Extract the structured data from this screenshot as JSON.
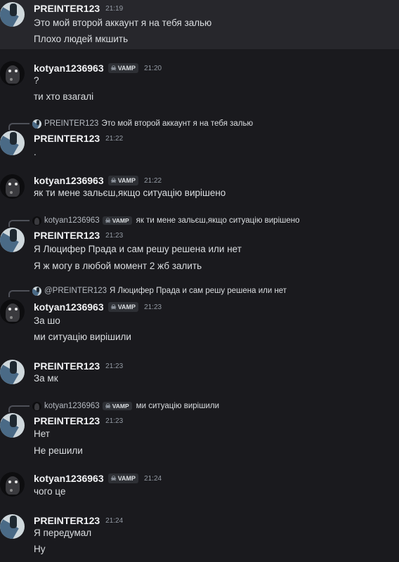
{
  "messages": [
    {
      "user": "PREINTER123",
      "time": "21:19",
      "lines": [
        "Это мой второй аккаунт я на тебя залью",
        "Плохо людей мкшить"
      ]
    },
    {
      "user": "kotyan1236963",
      "tag": "VAMP",
      "time": "21:20",
      "lines": [
        "?",
        "ти хто взагалі"
      ]
    },
    {
      "reply": {
        "name": "PREINTER123",
        "text": "Это мой второй аккаунт я на тебя залью"
      },
      "user": "PREINTER123",
      "time": "21:22",
      "lines": [
        "."
      ]
    },
    {
      "user": "kotyan1236963",
      "tag": "VAMP",
      "time": "21:22",
      "lines": [
        "як ти мене зальєш,якщо ситуацію вирішено"
      ]
    },
    {
      "reply": {
        "name": "kotyan1236963",
        "tag": "VAMP",
        "text": "як ти мене зальєш,якщо ситуацію вирішено"
      },
      "user": "PREINTER123",
      "time": "21:23",
      "lines": [
        "Я Люцифер Прада и сам решу решена или нет",
        "Я ж могу в любой момент 2 жб залить"
      ]
    },
    {
      "reply": {
        "name": "@PREINTER123",
        "text": "Я Люцифер Прада и сам решу решена или нет"
      },
      "user": "kotyan1236963",
      "tag": "VAMP",
      "time": "21:23",
      "lines": [
        "За шо",
        "ми ситуацію вирішили"
      ]
    },
    {
      "user": "PREINTER123",
      "time": "21:23",
      "lines": [
        "За мк"
      ]
    },
    {
      "reply": {
        "name": "kotyan1236963",
        "tag": "VAMP",
        "text": "ми ситуацію вирішили"
      },
      "user": "PREINTER123",
      "time": "21:23",
      "lines": [
        "Нет",
        "Не решили"
      ]
    },
    {
      "user": "kotyan1236963",
      "tag": "VAMP",
      "time": "21:24",
      "lines": [
        "чого це"
      ]
    },
    {
      "user": "PREINTER123",
      "time": "21:24",
      "lines": [
        "Я передумал",
        "Ну"
      ]
    }
  ]
}
